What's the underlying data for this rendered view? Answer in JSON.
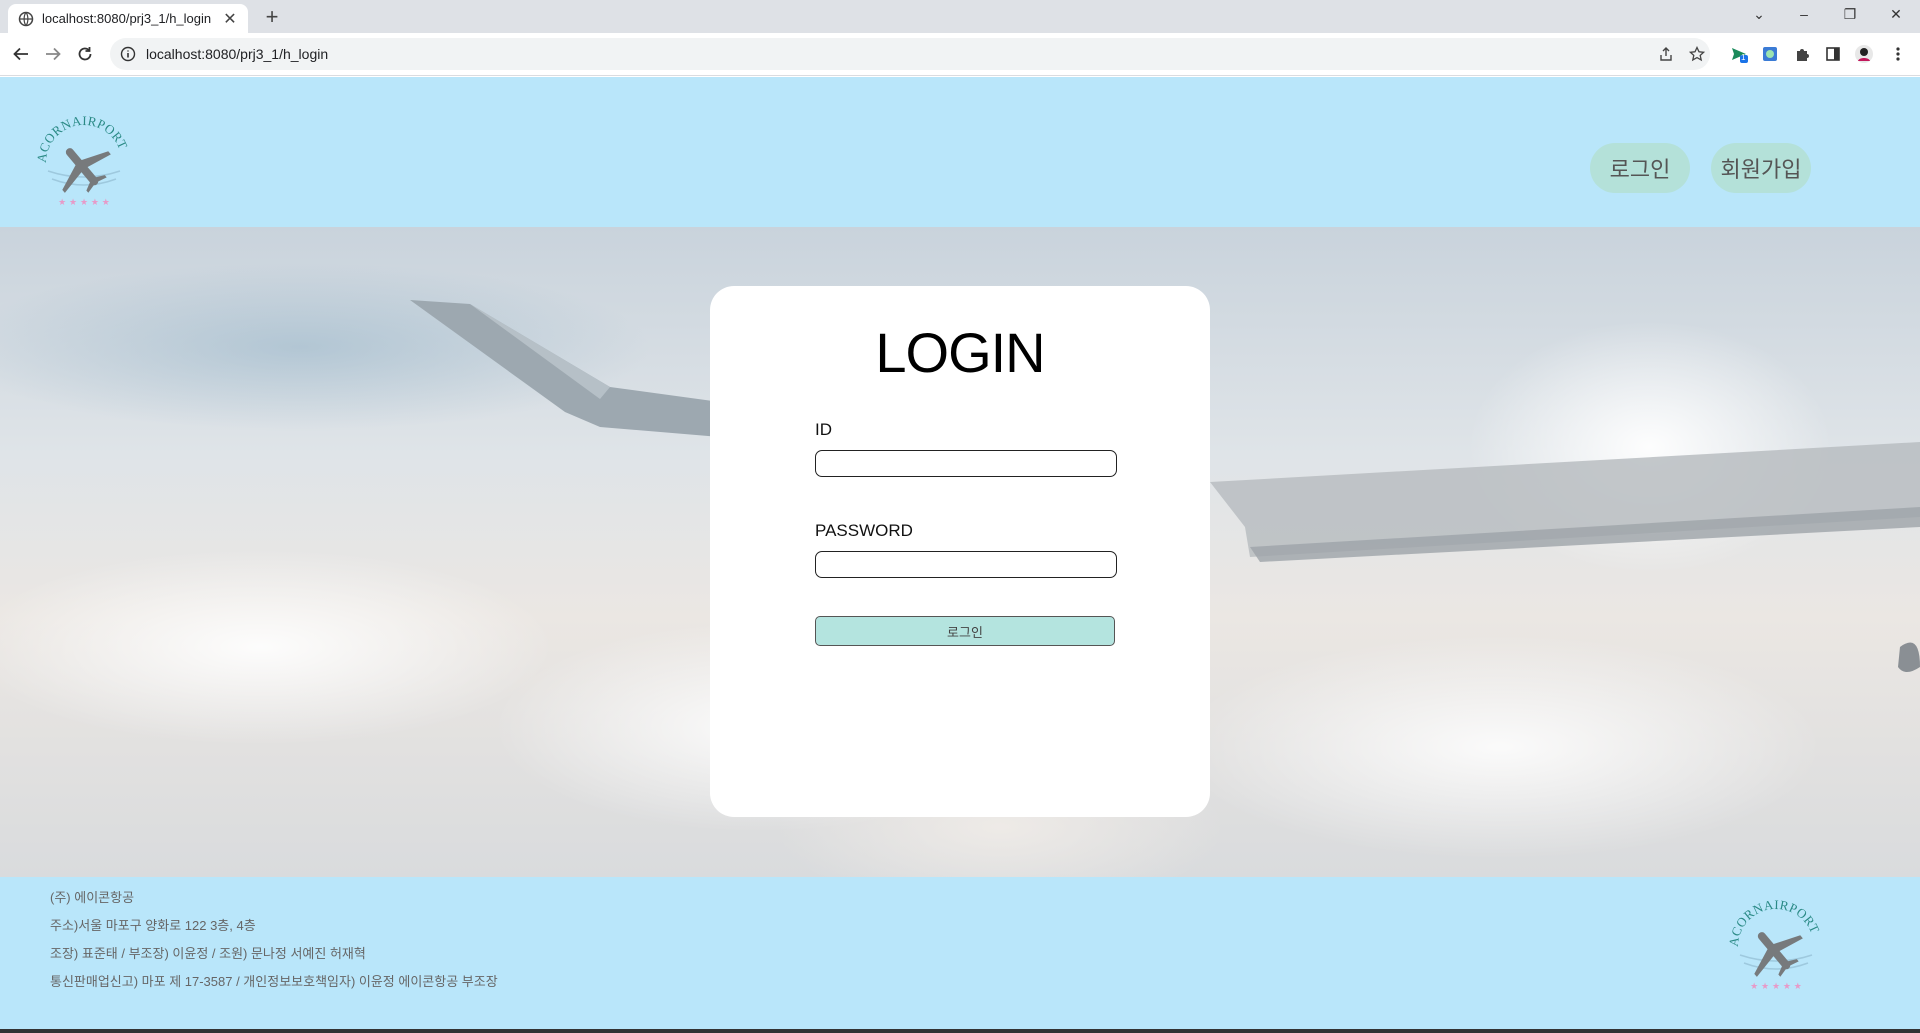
{
  "browser": {
    "tab_title": "localhost:8080/prj3_1/h_login",
    "url": "localhost:8080/prj3_1/h_login",
    "extension_badge": "1"
  },
  "header": {
    "logo_text": "ACORNAIRPORT",
    "nav_login": "로그인",
    "nav_signup": "회원가입"
  },
  "login_card": {
    "title": "LOGIN",
    "id_label": "ID",
    "id_value": "",
    "password_label": "PASSWORD",
    "password_value": "",
    "submit_label": "로그인"
  },
  "footer": {
    "lines": [
      "(주) 에이콘항공",
      "주소)서울 마포구 양화로 122 3층, 4층",
      "조장) 표준태 / 부조장) 이윤정 / 조원) 문나정 서예진 허재혁",
      "통신판매업신고) 마포 제 17-3587 / 개인정보보호책임자) 이윤정 에이콘항공 부조장"
    ],
    "logo_text": "ACORNAIRPORT"
  },
  "colors": {
    "header_bg": "#b9e6fa",
    "pill_bg": "#b4e1d9",
    "submit_bg": "#b4e4df"
  }
}
